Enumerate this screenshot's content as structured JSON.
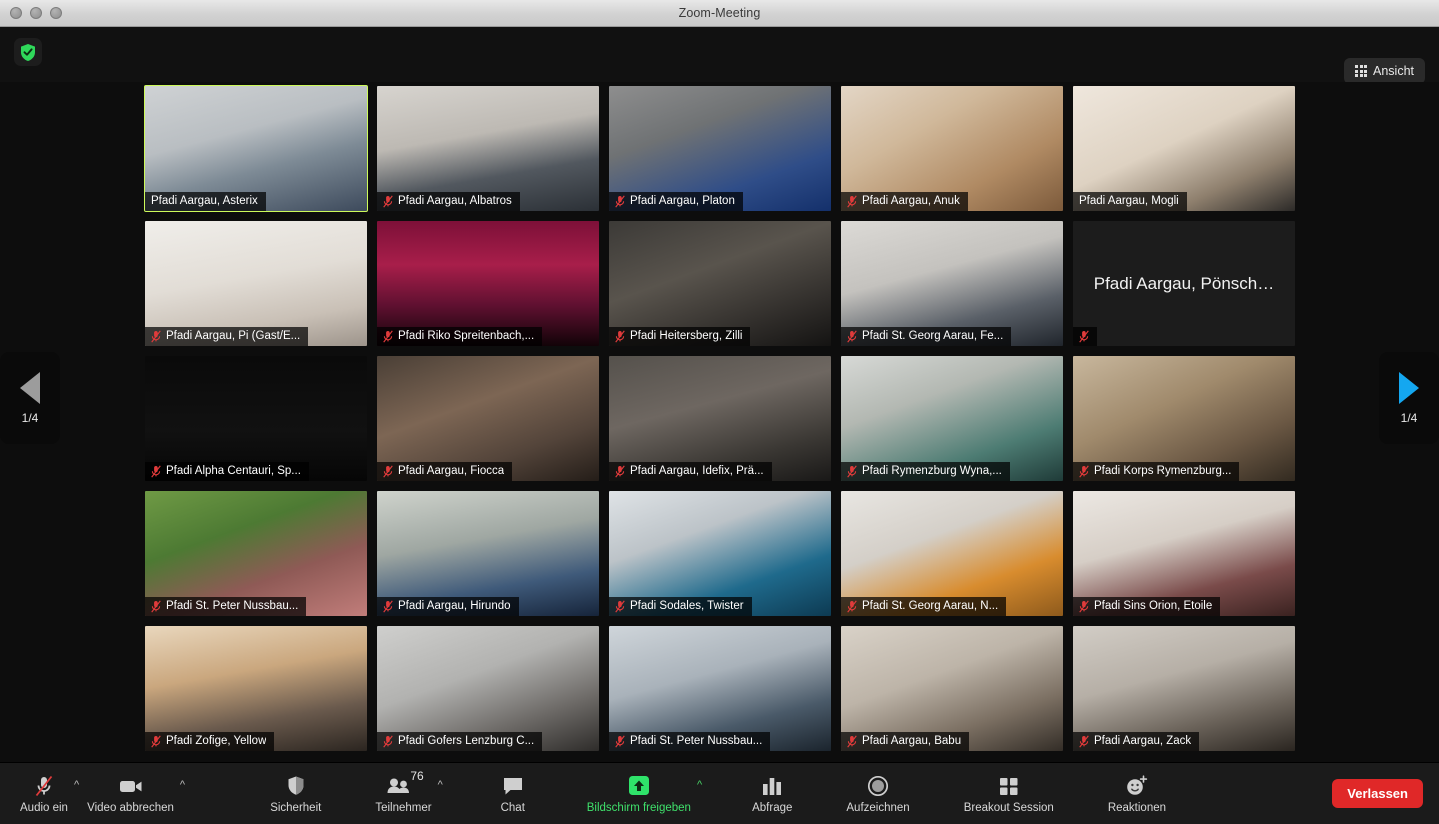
{
  "window": {
    "title": "Zoom-Meeting",
    "traffic_lights": [
      "close",
      "minimize",
      "zoom"
    ]
  },
  "topbar": {
    "security_badge_icon": "shield-check-icon",
    "security_badge_color": "#2fd85a",
    "view_button": {
      "label": "Ansicht",
      "icon": "grid-view-icon"
    }
  },
  "pagination": {
    "prev": {
      "label": "1/4",
      "icon": "triangle-left-icon",
      "color": "#9c9c9c"
    },
    "next": {
      "label": "1/4",
      "icon": "triangle-right-icon",
      "color": "#14a7f0"
    }
  },
  "grid": {
    "rows": 5,
    "cols": 5,
    "active_speaker_border_color": "#cdfa5a",
    "participants": [
      {
        "name": "Pfadi Aargau, Asterix",
        "muted": false,
        "active": true,
        "video": true,
        "bg": "linear-gradient(165deg,#cfd2d4 0%,#b9bec2 38%,#7e8b96 62%,#3d4a5c 100%)"
      },
      {
        "name": "Pfadi Aargau, Albatros",
        "muted": true,
        "active": false,
        "video": true,
        "bg": "linear-gradient(170deg,#d7d4cf 0%,#bdb9b3 40%,#52585f 68%,#2b3036 100%)"
      },
      {
        "name": "Pfadi Aargau, Platon",
        "muted": true,
        "active": false,
        "video": true,
        "bg": "linear-gradient(160deg,#8e8e8e 0%,#6f7274 35%,#2f4d88 72%,#14306b 100%)"
      },
      {
        "name": "Pfadi Aargau, Anuk",
        "muted": true,
        "active": false,
        "video": true,
        "bg": "linear-gradient(150deg,#e3d6c6 0%,#d0b89a 35%,#b08a63 70%,#7c5a3b 100%)"
      },
      {
        "name": "Pfadi Aargau, Mogli",
        "muted": false,
        "active": false,
        "video": true,
        "bg": "linear-gradient(155deg,#efe7dd 0%,#ded2c2 45%,#8e7f6d 75%,#2c2a28 100%)"
      },
      {
        "name": "Pfadi Aargau, Pi (Gast/E...",
        "muted": true,
        "active": false,
        "video": true,
        "bg": "linear-gradient(170deg,#f0eeea 0%,#e2ddd6 45%,#c9c0b6 75%,#9d948b 100%)"
      },
      {
        "name": "Pfadi Riko Spreitenbach,...",
        "muted": true,
        "active": false,
        "video": true,
        "bg": "linear-gradient(180deg,#7d1038 0%,#a81e4a 35%,#5e1030 68%,#120308 100%)"
      },
      {
        "name": "Pfadi Heitersberg, Zilli",
        "muted": true,
        "active": false,
        "video": true,
        "bg": "linear-gradient(160deg,#3c3a37 0%,#59544d 40%,#312e2b 75%,#141312 100%)"
      },
      {
        "name": "Pfadi St. Georg Aarau, Fe...",
        "muted": true,
        "active": false,
        "video": true,
        "bg": "linear-gradient(165deg,#dcdad6 0%,#c4c2be 40%,#5a6068 72%,#20252c 100%)"
      },
      {
        "name": "Pfadi Aargau, Pönsch…",
        "muted": true,
        "active": false,
        "video": false,
        "bg": "#1c1c1c"
      },
      {
        "name": "Pfadi Alpha Centauri, Sp...",
        "muted": true,
        "active": false,
        "video": true,
        "bg": "linear-gradient(180deg,#0a0a0a 0%,#111111 60%,#060606 100%)"
      },
      {
        "name": "Pfadi Aargau, Fiocca",
        "muted": true,
        "active": false,
        "video": true,
        "bg": "linear-gradient(160deg,#4a3f36 0%,#7d6654 40%,#53443a 72%,#241d18 100%)"
      },
      {
        "name": "Pfadi Aargau, Idefix, Prä...",
        "muted": true,
        "active": false,
        "video": true,
        "bg": "linear-gradient(165deg,#55514c 0%,#6e6761 40%,#3a3733 75%,#191817 100%)"
      },
      {
        "name": "Pfadi Rymenzburg Wyna,...",
        "muted": true,
        "active": false,
        "video": true,
        "bg": "linear-gradient(160deg,#d7d9d6 0%,#b3b8b2 35%,#4d7c73 72%,#1f3b38 100%)"
      },
      {
        "name": "Pfadi Korps Rymenzburg...",
        "muted": true,
        "active": false,
        "video": true,
        "bg": "linear-gradient(155deg,#c8b79d 0%,#a08a6c 40%,#6b5844 72%,#322a20 100%)"
      },
      {
        "name": "Pfadi St. Peter Nussbau...",
        "muted": true,
        "active": false,
        "video": true,
        "bg": "linear-gradient(160deg,#6f9a45 0%,#4d7a33 35%,#8f5a56 65%,#c17d7a 100%)"
      },
      {
        "name": "Pfadi Aargau, Hirundo",
        "muted": true,
        "active": false,
        "video": true,
        "bg": "linear-gradient(170deg,#cfd3cc 0%,#9fa7a2 40%,#3f5a7a 72%,#16243a 100%)"
      },
      {
        "name": "Pfadi Sodales, Twister",
        "muted": true,
        "active": false,
        "video": true,
        "bg": "linear-gradient(160deg,#dfe3e6 0%,#bcc3c8 35%,#1f6a8c 70%,#0d3a52 100%)"
      },
      {
        "name": "Pfadi St. Georg Aarau, N...",
        "muted": true,
        "active": false,
        "video": true,
        "bg": "linear-gradient(160deg,#e8e6e2 0%,#d4cfc8 38%,#d88c2e 70%,#8e5a1c 100%)"
      },
      {
        "name": "Pfadi Sins Orion, Etoile",
        "muted": true,
        "active": false,
        "video": true,
        "bg": "linear-gradient(165deg,#ece8e3 0%,#d6cec6 40%,#7a4b4a 72%,#3a2220 100%)"
      },
      {
        "name": "Pfadi Zofige, Yellow",
        "muted": true,
        "active": false,
        "video": true,
        "bg": "linear-gradient(170deg,#e9d7bd 0%,#caa77e 38%,#6a5a4d 70%,#2b2520 100%)"
      },
      {
        "name": "Pfadi Gofers Lenzburg C...",
        "muted": true,
        "active": false,
        "video": true,
        "bg": "linear-gradient(160deg,#cfcfcd 0%,#b2b2b0 40%,#6d6a67 72%,#2e2c2a 100%)"
      },
      {
        "name": "Pfadi St. Peter Nussbau...",
        "muted": true,
        "active": false,
        "video": true,
        "bg": "linear-gradient(165deg,#cfd5da 0%,#a9b2ba 40%,#4a5a69 72%,#1b242d 100%)"
      },
      {
        "name": "Pfadi Aargau, Babu",
        "muted": true,
        "active": false,
        "video": true,
        "bg": "linear-gradient(160deg,#d9d2c8 0%,#bdb4a8 40%,#7b6f62 72%,#332d27 100%)"
      },
      {
        "name": "Pfadi Aargau, Zack",
        "muted": true,
        "active": false,
        "video": true,
        "bg": "linear-gradient(165deg,#d2cdc6 0%,#b6afa6 40%,#6b635a 72%,#2a2520 100%)"
      }
    ]
  },
  "toolbar": {
    "audio": {
      "label": "Audio ein",
      "icon": "microphone-muted-icon",
      "has_caret": true
    },
    "video": {
      "label": "Video abbrechen",
      "icon": "camera-icon",
      "has_caret": true
    },
    "security": {
      "label": "Sicherheit",
      "icon": "shield-icon"
    },
    "participants": {
      "label": "Teilnehmer",
      "icon": "people-icon",
      "count": "76",
      "has_caret": true
    },
    "chat": {
      "label": "Chat",
      "icon": "chat-bubble-icon"
    },
    "share_screen": {
      "label": "Bildschirm freigeben",
      "icon": "share-screen-up-arrow-icon",
      "color": "#3fe06b",
      "has_caret": true
    },
    "poll": {
      "label": "Abfrage",
      "icon": "bar-chart-icon"
    },
    "record": {
      "label": "Aufzeichnen",
      "icon": "record-circle-icon"
    },
    "breakout": {
      "label": "Breakout Session",
      "icon": "four-squares-icon"
    },
    "reactions": {
      "label": "Reaktionen",
      "icon": "smiley-plus-icon"
    },
    "leave": {
      "label": "Verlassen",
      "color": "#e02828"
    }
  }
}
